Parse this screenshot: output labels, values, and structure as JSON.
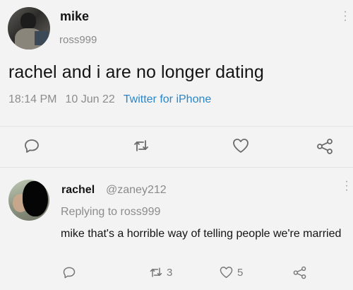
{
  "tweet": {
    "author_name": "mike",
    "author_handle": "ross999",
    "text": "rachel and i are no longer dating",
    "time": "18:14 PM",
    "date": "10 Jun 22",
    "source": "Twitter for iPhone"
  },
  "reply": {
    "author_name": "rachel",
    "author_handle": "@zaney212",
    "replying_to": "Replying to ross999",
    "text": "mike that's a horrible way of telling people we're married",
    "retweet_count": "3",
    "like_count": "5"
  },
  "colors": {
    "background": "#f3f3f3",
    "link_blue": "#2a86c9",
    "muted_gray": "#8c8c8c",
    "icon_gray": "#7a7a7a"
  }
}
